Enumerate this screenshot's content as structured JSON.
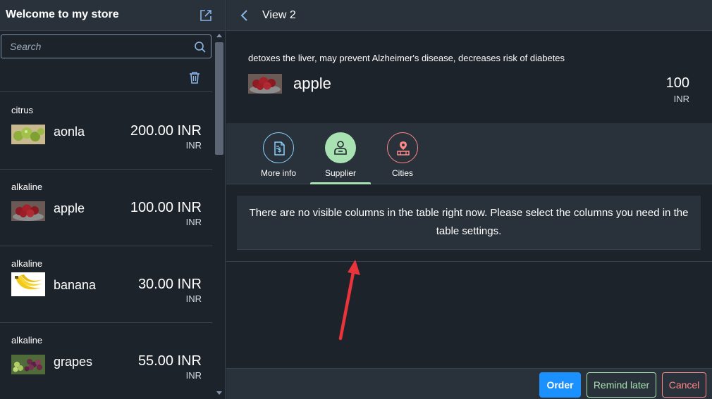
{
  "master": {
    "title": "Welcome to my store",
    "search_placeholder": "Search",
    "items": [
      {
        "category": "citrus",
        "name": "aonla",
        "price": "200.00 INR",
        "currency": "INR"
      },
      {
        "category": "alkaline",
        "name": "apple",
        "price": "100.00 INR",
        "currency": "INR"
      },
      {
        "category": "alkaline",
        "name": "banana",
        "price": "30.00 INR",
        "currency": "INR"
      },
      {
        "category": "alkaline",
        "name": "grapes",
        "price": "55.00 INR",
        "currency": "INR"
      }
    ]
  },
  "detail": {
    "title": "View 2",
    "description": "detoxes the liver, may prevent Alzheimer's disease, decreases risk of diabetes",
    "object_title": "apple",
    "price": "100",
    "currency": "INR",
    "tabs": [
      {
        "label": "More info",
        "icon": "document-dollar-icon",
        "color": "#89d1ff"
      },
      {
        "label": "Supplier",
        "icon": "person-icon",
        "color": "#a8e1b2",
        "selected": true
      },
      {
        "label": "Cities",
        "icon": "location-icon",
        "color": "#ff8888"
      }
    ],
    "no_data_text": "There are no visible columns in the table right now. Please select the columns you need in the table settings."
  },
  "footer": {
    "order_label": "Order",
    "remind_label": "Remind later",
    "cancel_label": "Cancel"
  },
  "colors": {
    "background": "#1d232a",
    "shell": "#29313a",
    "accent_blue": "#1b90ff",
    "accent_green": "#a8e1b2",
    "accent_red": "#ff8888",
    "annotation_arrow": "#e8343a"
  }
}
